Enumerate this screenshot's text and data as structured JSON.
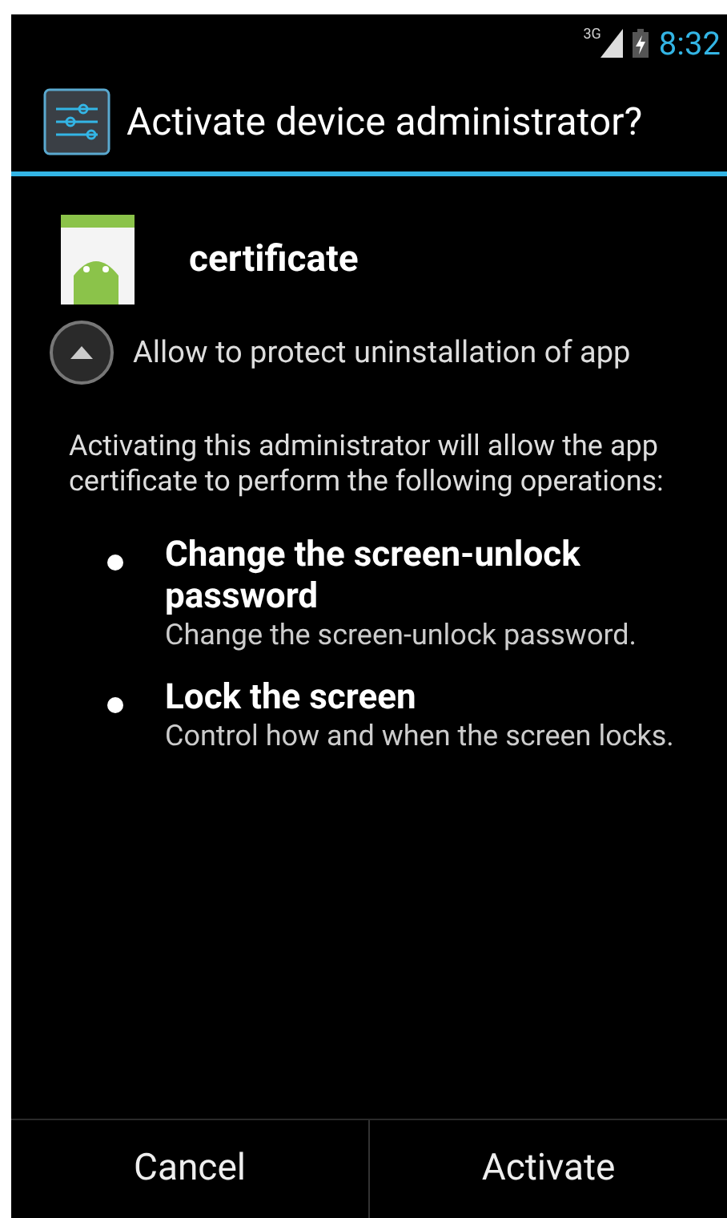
{
  "status_bar": {
    "network": "3G",
    "time": "8:32"
  },
  "title": "Activate device administrator?",
  "app": {
    "name": "certificate"
  },
  "details": {
    "expanded": true,
    "label": "Allow to protect uninstallation of app"
  },
  "description": "Activating this administrator will allow the app certificate to perform the following operations:",
  "policies": [
    {
      "title": "Change the screen-unlock password",
      "detail": "Change the screen-unlock password."
    },
    {
      "title": "Lock the screen",
      "detail": "Control how and when the screen locks."
    }
  ],
  "buttons": [
    {
      "label": "Cancel"
    },
    {
      "label": "Activate"
    }
  ]
}
